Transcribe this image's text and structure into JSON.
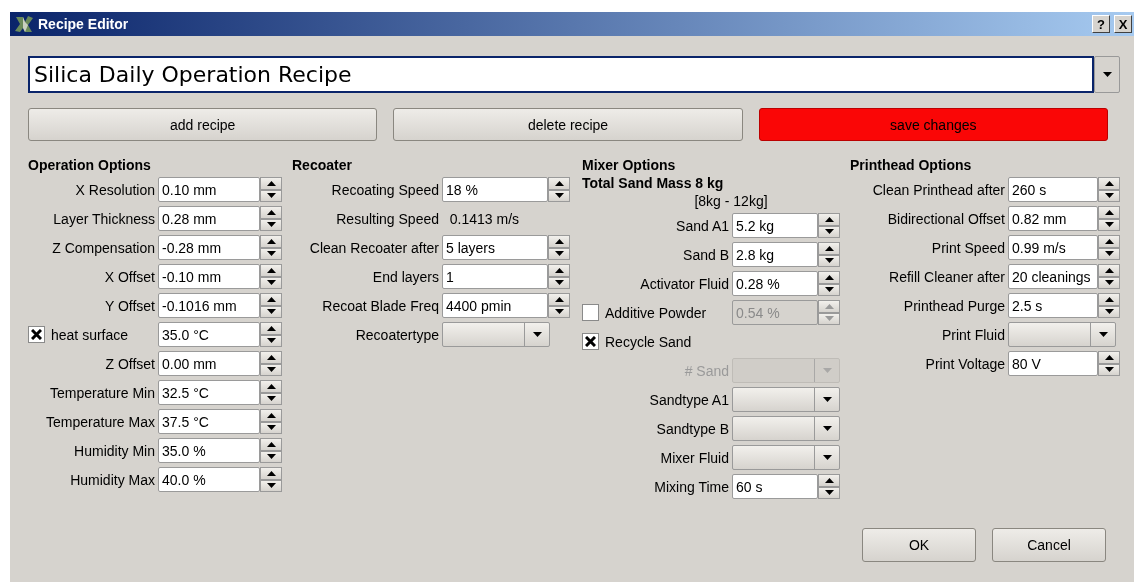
{
  "window": {
    "title": "Recipe Editor",
    "help": "?",
    "close": "X"
  },
  "recipe_name": {
    "value": "Silica Daily Operation Recipe"
  },
  "actions": [
    {
      "label": "add recipe",
      "highlighted": false
    },
    {
      "label": "delete recipe",
      "highlighted": false
    },
    {
      "label": "save changes",
      "highlighted": true
    }
  ],
  "columns": [
    {
      "title": "Operation Options",
      "rows": [
        {
          "kind": "spin",
          "label": "X Resolution",
          "value": "0.10 mm"
        },
        {
          "kind": "spin",
          "label": "Layer Thickness",
          "value": "0.28 mm"
        },
        {
          "kind": "spin",
          "label": "Z Compensation",
          "value": "-0.28 mm"
        },
        {
          "kind": "spin",
          "label": "X Offset",
          "value": "-0.10 mm"
        },
        {
          "kind": "spin",
          "label": "Y Offset",
          "value": "-0.1016 mm"
        },
        {
          "kind": "check",
          "label": "heat surface",
          "checked": true,
          "value": "35.0 °C",
          "disabled": false
        },
        {
          "kind": "spin",
          "label": "Z Offset",
          "value": "0.00 mm"
        },
        {
          "kind": "spin",
          "label": "Temperature Min",
          "value": "32.5 °C"
        },
        {
          "kind": "spin",
          "label": "Temperature Max",
          "value": "37.5 °C"
        },
        {
          "kind": "spin",
          "label": "Humidity Min",
          "value": "35.0 %"
        },
        {
          "kind": "spin",
          "label": "Humidity Max",
          "value": "40.0 %"
        }
      ]
    },
    {
      "title": "Recoater",
      "rows": [
        {
          "kind": "spin",
          "label": "Recoating Speed",
          "value": "18 %"
        },
        {
          "kind": "readout",
          "label": "Resulting Speed",
          "value": "0.1413 m/s"
        },
        {
          "kind": "spin",
          "label": "Clean Recoater after",
          "value": "5 layers"
        },
        {
          "kind": "spin",
          "label": "End layers",
          "value": "1"
        },
        {
          "kind": "spin",
          "label": "Recoat Blade Freq",
          "value": "4400 pmin"
        },
        {
          "kind": "combo",
          "label": "Recoatertype",
          "disabled": false
        }
      ]
    },
    {
      "title": "Mixer Options",
      "subtitle": "Total Sand Mass 8 kg",
      "note": "[8kg - 12kg]",
      "rows": [
        {
          "kind": "spin",
          "label": "Sand A1",
          "value": "5.2 kg"
        },
        {
          "kind": "spin",
          "label": "Sand B",
          "value": "2.8 kg"
        },
        {
          "kind": "spin",
          "label": "Activator Fluid",
          "value": "0.28 %"
        },
        {
          "kind": "check",
          "label": "Additive Powder",
          "checked": false,
          "value": "0.54 %",
          "disabled": true
        },
        {
          "kind": "check",
          "label": "Recycle Sand",
          "checked": true
        },
        {
          "kind": "combo",
          "label": "# Sand",
          "disabled": true
        },
        {
          "kind": "combo",
          "label": "Sandtype A1",
          "disabled": false
        },
        {
          "kind": "combo",
          "label": "Sandtype B",
          "disabled": false
        },
        {
          "kind": "combo",
          "label": "Mixer Fluid",
          "disabled": false
        },
        {
          "kind": "spin",
          "label": "Mixing Time",
          "value": "60 s"
        }
      ]
    },
    {
      "title": "Printhead Options",
      "rows": [
        {
          "kind": "spin",
          "label": "Clean Printhead after",
          "value": "260 s"
        },
        {
          "kind": "spin",
          "label": "Bidirectional Offset",
          "value": "0.82 mm"
        },
        {
          "kind": "spin",
          "label": "Print Speed",
          "value": "0.99 m/s"
        },
        {
          "kind": "spin",
          "label": "Refill Cleaner after",
          "value": "20 cleanings"
        },
        {
          "kind": "spin",
          "label": "Printhead Purge",
          "value": "2.5 s"
        },
        {
          "kind": "combo",
          "label": "Print Fluid",
          "disabled": false
        },
        {
          "kind": "spin",
          "label": "Print Voltage",
          "value": "80 V"
        }
      ]
    }
  ],
  "footer": [
    {
      "label": "OK"
    },
    {
      "label": "Cancel"
    }
  ]
}
